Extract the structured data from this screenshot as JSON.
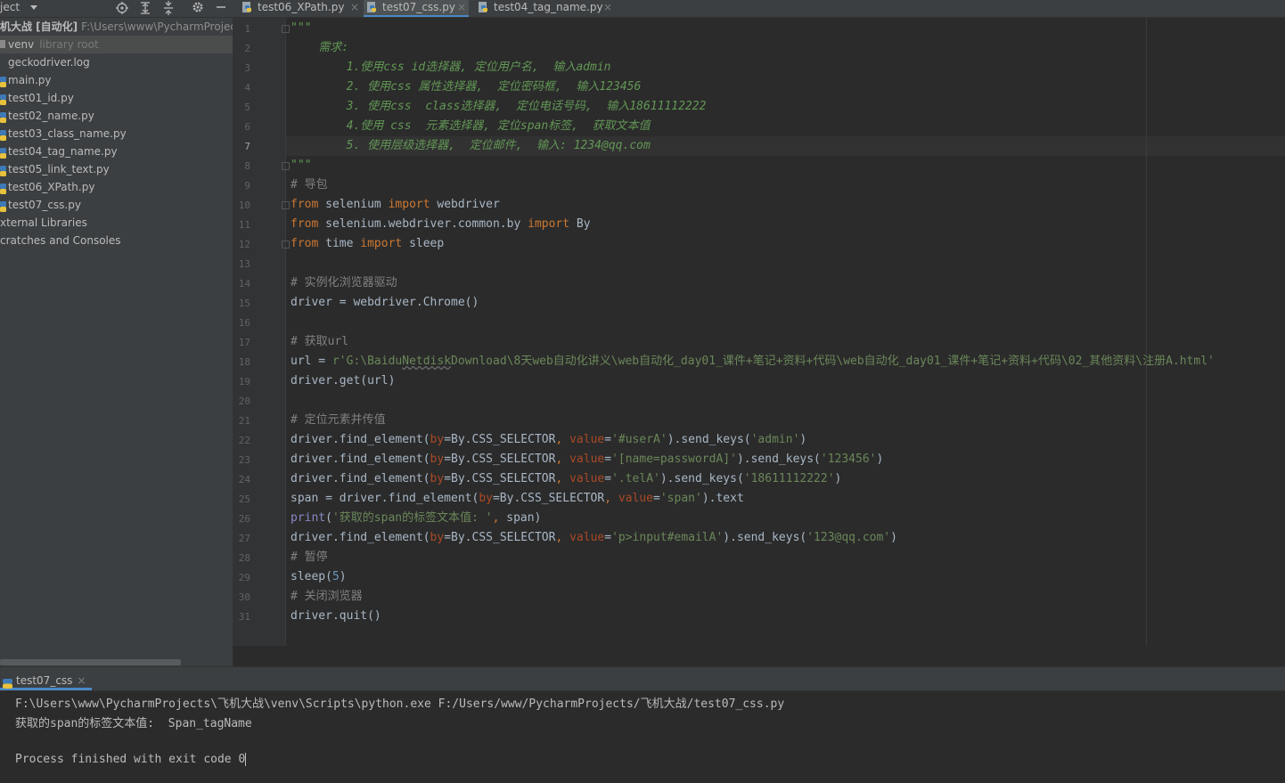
{
  "project": {
    "header_label": "ject",
    "title_name": "机大战 [自动化]",
    "title_path": "F:\\Users\\www\\PycharmProjec",
    "tree": [
      {
        "name": "venv",
        "hint": "library root",
        "kind": "folder",
        "selected": true
      },
      {
        "name": "geckodriver.log",
        "kind": "file"
      },
      {
        "name": "main.py",
        "kind": "py"
      },
      {
        "name": "test01_id.py",
        "kind": "py"
      },
      {
        "name": "test02_name.py",
        "kind": "py"
      },
      {
        "name": "test03_class_name.py",
        "kind": "py"
      },
      {
        "name": "test04_tag_name.py",
        "kind": "py"
      },
      {
        "name": "test05_link_text.py",
        "kind": "py"
      },
      {
        "name": "test06_XPath.py",
        "kind": "py"
      },
      {
        "name": "test07_css.py",
        "kind": "py"
      },
      {
        "name": "xternal Libraries",
        "kind": "plain"
      },
      {
        "name": "cratches and Consoles",
        "kind": "plain"
      }
    ]
  },
  "tabs": [
    {
      "label": "test06_XPath.py",
      "close": "×",
      "active": false
    },
    {
      "label": "test07_css.py",
      "close": "×",
      "active": true
    },
    {
      "label": "test04_tag_name.py",
      "close": "×",
      "active": false
    }
  ],
  "editor": {
    "line_numbers": [
      "1",
      "2",
      "3",
      "4",
      "5",
      "6",
      "7",
      "8",
      "9",
      "10",
      "11",
      "12",
      "13",
      "14",
      "15",
      "16",
      "17",
      "18",
      "19",
      "20",
      "21",
      "22",
      "23",
      "24",
      "25",
      "26",
      "27",
      "28",
      "29",
      "30",
      "31"
    ],
    "current_line": 7,
    "lines": [
      [
        [
          "doc",
          "\"\"\""
        ]
      ],
      [
        [
          "doc",
          "    需求:"
        ]
      ],
      [
        [
          "doc",
          "        1.使用css id选择器, 定位用户名,  输入admin"
        ]
      ],
      [
        [
          "doc",
          "        2. 使用css 属性选择器,  定位密码框,  输入123456"
        ]
      ],
      [
        [
          "doc",
          "        3. 使用css  class选择器,  定位电话号码,  输入18611112222"
        ]
      ],
      [
        [
          "doc",
          "        4.使用 css  元素选择器, 定位span标签,  获取文本值"
        ]
      ],
      [
        [
          "doc",
          "        5. 使用层级选择器,  定位邮件,  输入: 1234@qq.com"
        ]
      ],
      [
        [
          "doc",
          "\"\"\""
        ]
      ],
      [
        [
          "cm",
          "# 导包"
        ]
      ],
      [
        [
          "kw",
          "from"
        ],
        [
          "txt",
          " selenium "
        ],
        [
          "kw",
          "import"
        ],
        [
          "txt",
          " webdriver"
        ]
      ],
      [
        [
          "kw",
          "from"
        ],
        [
          "txt",
          " selenium.webdriver.common.by "
        ],
        [
          "kw",
          "import"
        ],
        [
          "txt",
          " By"
        ]
      ],
      [
        [
          "kw",
          "from"
        ],
        [
          "txt",
          " time "
        ],
        [
          "kw",
          "import"
        ],
        [
          "txt",
          " sleep"
        ]
      ],
      [],
      [
        [
          "cm",
          "# 实例化浏览器驱动"
        ]
      ],
      [
        [
          "txt",
          "driver = webdriver.Chrome()"
        ]
      ],
      [],
      [
        [
          "cm",
          "# 获取url"
        ]
      ],
      [
        [
          "txt",
          "url = "
        ],
        [
          "str",
          "r'G:\\Baidu"
        ],
        [
          "strund",
          "Netdisk"
        ],
        [
          "str",
          "Download\\8天web自动化讲义\\web自动化_day01_课件+笔记+资料+代码\\web自动化_day01_课件+笔记+资料+代码\\02_其他资料\\注册A.html'"
        ]
      ],
      [
        [
          "txt",
          "driver.get(url)"
        ]
      ],
      [],
      [
        [
          "cm",
          "# 定位元素并传值"
        ]
      ],
      [
        [
          "txt",
          "driver.find_element("
        ],
        [
          "prm",
          "by"
        ],
        [
          "txt",
          "=By.CSS_SELECTOR"
        ],
        [
          "kw",
          ", "
        ],
        [
          "prm",
          "value"
        ],
        [
          "txt",
          "="
        ],
        [
          "str",
          "'#userA'"
        ],
        [
          "txt",
          ").send_keys("
        ],
        [
          "str",
          "'admin'"
        ],
        [
          "txt",
          ")"
        ]
      ],
      [
        [
          "txt",
          "driver.find_element("
        ],
        [
          "prm",
          "by"
        ],
        [
          "txt",
          "=By.CSS_SELECTOR"
        ],
        [
          "kw",
          ", "
        ],
        [
          "prm",
          "value"
        ],
        [
          "txt",
          "="
        ],
        [
          "str",
          "'[name=passwordA]'"
        ],
        [
          "txt",
          ").send_keys("
        ],
        [
          "str",
          "'123456'"
        ],
        [
          "txt",
          ")"
        ]
      ],
      [
        [
          "txt",
          "driver.find_element("
        ],
        [
          "prm",
          "by"
        ],
        [
          "txt",
          "=By.CSS_SELECTOR"
        ],
        [
          "kw",
          ", "
        ],
        [
          "prm",
          "value"
        ],
        [
          "txt",
          "="
        ],
        [
          "str",
          "'.telA'"
        ],
        [
          "txt",
          ").send_keys("
        ],
        [
          "str",
          "'18611112222'"
        ],
        [
          "txt",
          ")"
        ]
      ],
      [
        [
          "txt",
          "span = driver.find_element("
        ],
        [
          "prm",
          "by"
        ],
        [
          "txt",
          "=By.CSS_SELECTOR"
        ],
        [
          "kw",
          ", "
        ],
        [
          "prm",
          "value"
        ],
        [
          "txt",
          "="
        ],
        [
          "str",
          "'span'"
        ],
        [
          "txt",
          ").text"
        ]
      ],
      [
        [
          "bi",
          "print"
        ],
        [
          "txt",
          "("
        ],
        [
          "str",
          "'获取的span的标签文本值: '"
        ],
        [
          "kw",
          ", "
        ],
        [
          "txt",
          "span)"
        ]
      ],
      [
        [
          "txt",
          "driver.find_element("
        ],
        [
          "prm",
          "by"
        ],
        [
          "txt",
          "=By.CSS_SELECTOR"
        ],
        [
          "kw",
          ", "
        ],
        [
          "prm",
          "value"
        ],
        [
          "txt",
          "="
        ],
        [
          "str",
          "'p>input#emailA'"
        ],
        [
          "txt",
          ").send_keys("
        ],
        [
          "str",
          "'123@qq.com'"
        ],
        [
          "txt",
          ")"
        ]
      ],
      [
        [
          "cm",
          "# 暂停"
        ]
      ],
      [
        [
          "txt",
          "sleep("
        ],
        [
          "num",
          "5"
        ],
        [
          "txt",
          ")"
        ]
      ],
      [
        [
          "cm",
          "# 关闭浏览器"
        ]
      ],
      [
        [
          "txt",
          "driver.quit()"
        ]
      ]
    ]
  },
  "run": {
    "tab_label": "test07_css",
    "tab_close": "×",
    "output": [
      "F:\\Users\\www\\PycharmProjects\\飞机大战\\venv\\Scripts\\python.exe F:/Users/www/PycharmProjects/飞机大战/test07_css.py",
      "获取的span的标签文本值:  Span_tagName",
      "",
      "Process finished with exit code 0"
    ]
  },
  "colors": {
    "accent": "#4a88c7",
    "keyword": "#cc7832",
    "string": "#6a8759",
    "docstring": "#629755",
    "comment": "#808080",
    "param": "#aa4926",
    "builtin": "#8888c6",
    "number": "#6897bb"
  },
  "icons": {
    "locate": "crosshair-icon",
    "expand": "expand-all-icon",
    "collapse": "collapse-all-icon",
    "settings": "gear-icon",
    "hide": "minimize-icon"
  }
}
